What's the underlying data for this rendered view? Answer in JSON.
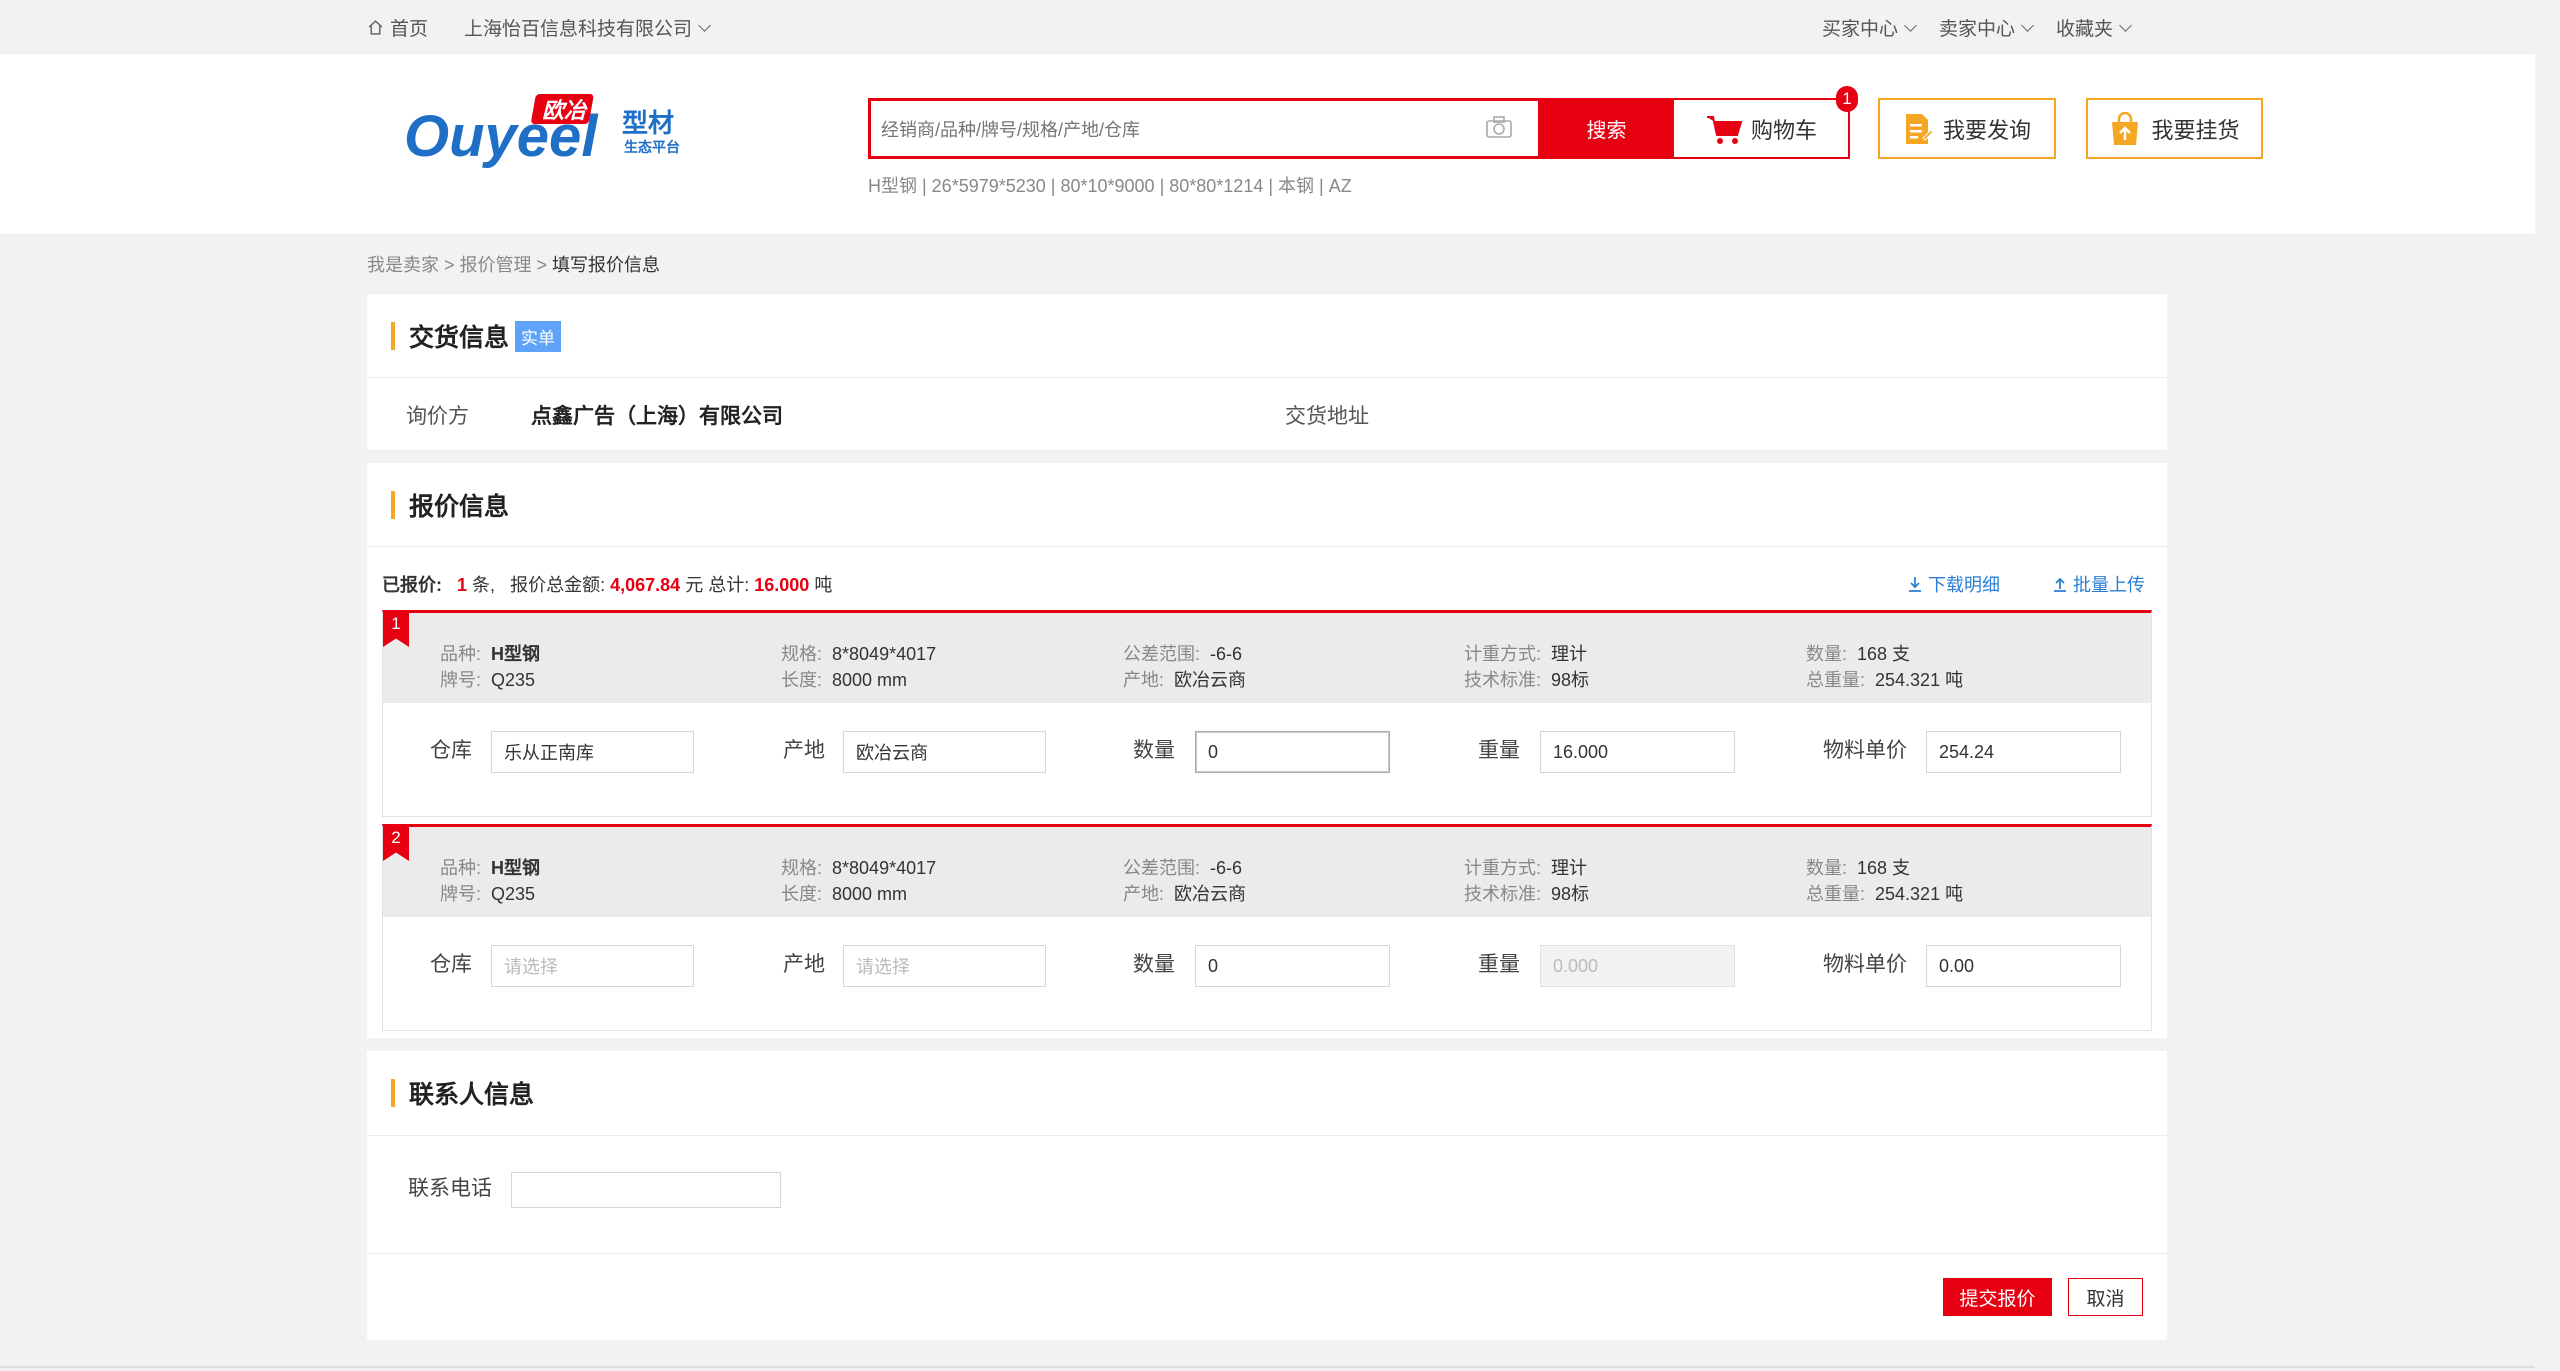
{
  "topbar": {
    "home": "首页",
    "company": "上海怡百信息科技有限公司",
    "menus": [
      "买家中心",
      "卖家中心",
      "收藏夹"
    ]
  },
  "header": {
    "logo_text": "Ouyeel",
    "logo_badge": "欧冶",
    "logo_sub": "型材",
    "logo_tagline": "生态平台",
    "search_placeholder": "经销商/品种/牌号/规格/产地/仓库",
    "search_btn": "搜索",
    "cart_btn": "购物车",
    "cart_count": "1",
    "inquiry_btn": "我要发询",
    "sell_btn": "我要挂货",
    "hotwords": "H型钢 | 26*5979*5230 | 80*10*9000 | 80*80*1214 | 本钢 | AZ"
  },
  "breadcrumb": {
    "a": "我是卖家",
    "sep1": " > ",
    "b": "报价管理",
    "sep2": " > ",
    "current": "填写报价信息"
  },
  "delivery": {
    "title": "交货信息",
    "tag": "实单",
    "inquirer_label": "询价方",
    "inquirer_value": "点鑫广告（上海）有限公司",
    "address_label": "交货地址"
  },
  "quote": {
    "title": "报价信息",
    "summary_label": "已报价:",
    "count": "1",
    "count_unit": "条,",
    "amount_label": "报价总金额:",
    "amount": "4,067.84",
    "amount_unit": "元 总计:",
    "weight": "16.000",
    "weight_unit": "吨",
    "download": "下载明细",
    "upload": "批量上传",
    "labels": {
      "variety": "品种:",
      "grade": "牌号:",
      "spec": "规格:",
      "length": "长度:",
      "tolerance": "公差范围:",
      "origin": "产地:",
      "measure": "计重方式:",
      "standard": "技术标准:",
      "quantity": "数量:",
      "total_weight": "总重量:",
      "warehouse_f": "仓库",
      "origin_f": "产地",
      "quantity_f": "数量",
      "weight_f": "重量",
      "price_f": "物料单价"
    },
    "items": [
      {
        "no": "1",
        "variety": "H型钢",
        "grade": "Q235",
        "spec": "8*8049*4017",
        "length": "8000 mm",
        "tolerance": "-6-6",
        "origin": "欧冶云商",
        "measure": "理计",
        "standard": "98标",
        "quantity": "168 支",
        "total_weight": "254.321 吨",
        "warehouse": "乐从正南库",
        "origin_in": "欧冶云商",
        "qty_in": "0",
        "weight_in": "16.000",
        "price_in": "254.24"
      },
      {
        "no": "2",
        "variety": "H型钢",
        "grade": "Q235",
        "spec": "8*8049*4017",
        "length": "8000 mm",
        "tolerance": "-6-6",
        "origin": "欧冶云商",
        "measure": "理计",
        "standard": "98标",
        "quantity": "168 支",
        "total_weight": "254.321 吨",
        "warehouse": "请选择",
        "origin_in": "请选择",
        "qty_in": "0",
        "weight_in": "0.000",
        "price_in": "0.00"
      }
    ]
  },
  "contact": {
    "title": "联系人信息",
    "phone_label": "联系电话",
    "phone_value": ""
  },
  "actions": {
    "submit": "提交报价",
    "cancel": "取消"
  },
  "colors": {
    "brand_red": "#e60012",
    "accent_orange": "#f5a623",
    "link_blue": "#2a7fd4",
    "logo_blue": "#1f6fc6"
  }
}
